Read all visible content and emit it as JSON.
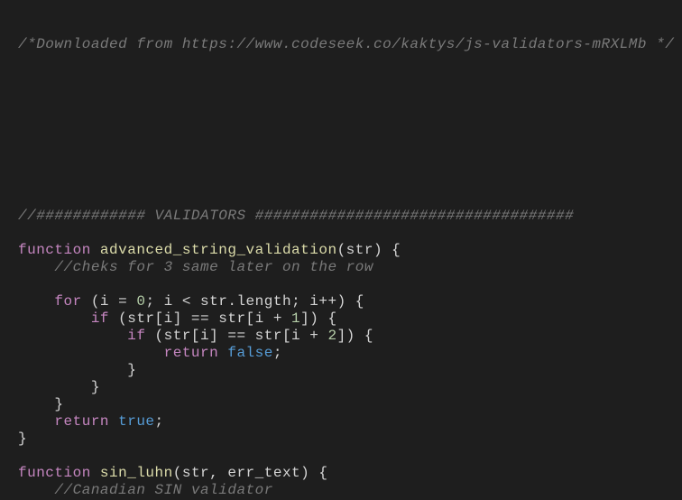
{
  "lines": [
    {
      "tokens": []
    },
    {
      "tokens": []
    },
    {
      "tokens": [
        {
          "cls": "comment",
          "text": "/*Downloaded from https://www.codeseek.co/kaktys/js-validators-mRXLMb */"
        }
      ]
    },
    {
      "tokens": []
    },
    {
      "tokens": []
    },
    {
      "tokens": []
    },
    {
      "tokens": []
    },
    {
      "tokens": []
    },
    {
      "tokens": []
    },
    {
      "tokens": []
    },
    {
      "tokens": []
    },
    {
      "tokens": []
    },
    {
      "tokens": [
        {
          "cls": "comment",
          "text": "//############ VALIDATORS ###################################"
        }
      ]
    },
    {
      "tokens": []
    },
    {
      "tokens": [
        {
          "cls": "keyword-decl",
          "text": "function"
        },
        {
          "cls": "plain",
          "text": " "
        },
        {
          "cls": "func-name",
          "text": "advanced_string_validation"
        },
        {
          "cls": "punct",
          "text": "(str) {"
        }
      ]
    },
    {
      "tokens": [
        {
          "cls": "plain",
          "text": "    "
        },
        {
          "cls": "comment",
          "text": "//cheks for 3 same later on the row"
        }
      ]
    },
    {
      "tokens": []
    },
    {
      "tokens": [
        {
          "cls": "plain",
          "text": "    "
        },
        {
          "cls": "keyword",
          "text": "for"
        },
        {
          "cls": "plain",
          "text": " (i = "
        },
        {
          "cls": "number",
          "text": "0"
        },
        {
          "cls": "plain",
          "text": "; i < str.length; i++) {"
        }
      ]
    },
    {
      "tokens": [
        {
          "cls": "plain",
          "text": "        "
        },
        {
          "cls": "keyword",
          "text": "if"
        },
        {
          "cls": "plain",
          "text": " (str[i] == str[i + "
        },
        {
          "cls": "number",
          "text": "1"
        },
        {
          "cls": "plain",
          "text": "]) {"
        }
      ]
    },
    {
      "tokens": [
        {
          "cls": "plain",
          "text": "            "
        },
        {
          "cls": "keyword",
          "text": "if"
        },
        {
          "cls": "plain",
          "text": " (str[i] == str[i + "
        },
        {
          "cls": "number",
          "text": "2"
        },
        {
          "cls": "plain",
          "text": "]) {"
        }
      ]
    },
    {
      "tokens": [
        {
          "cls": "plain",
          "text": "                "
        },
        {
          "cls": "keyword",
          "text": "return"
        },
        {
          "cls": "plain",
          "text": " "
        },
        {
          "cls": "bool",
          "text": "false"
        },
        {
          "cls": "plain",
          "text": ";"
        }
      ]
    },
    {
      "tokens": [
        {
          "cls": "plain",
          "text": "            }"
        }
      ]
    },
    {
      "tokens": [
        {
          "cls": "plain",
          "text": "        }"
        }
      ]
    },
    {
      "tokens": [
        {
          "cls": "plain",
          "text": "    }"
        }
      ]
    },
    {
      "tokens": [
        {
          "cls": "plain",
          "text": "    "
        },
        {
          "cls": "keyword",
          "text": "return"
        },
        {
          "cls": "plain",
          "text": " "
        },
        {
          "cls": "bool",
          "text": "true"
        },
        {
          "cls": "plain",
          "text": ";"
        }
      ]
    },
    {
      "tokens": [
        {
          "cls": "plain",
          "text": "}"
        }
      ]
    },
    {
      "tokens": []
    },
    {
      "tokens": [
        {
          "cls": "keyword-decl",
          "text": "function"
        },
        {
          "cls": "plain",
          "text": " "
        },
        {
          "cls": "func-name",
          "text": "sin_luhn"
        },
        {
          "cls": "plain",
          "text": "(str, err_text) {"
        }
      ]
    },
    {
      "tokens": [
        {
          "cls": "plain",
          "text": "    "
        },
        {
          "cls": "comment",
          "text": "//Canadian SIN validator"
        }
      ]
    }
  ]
}
